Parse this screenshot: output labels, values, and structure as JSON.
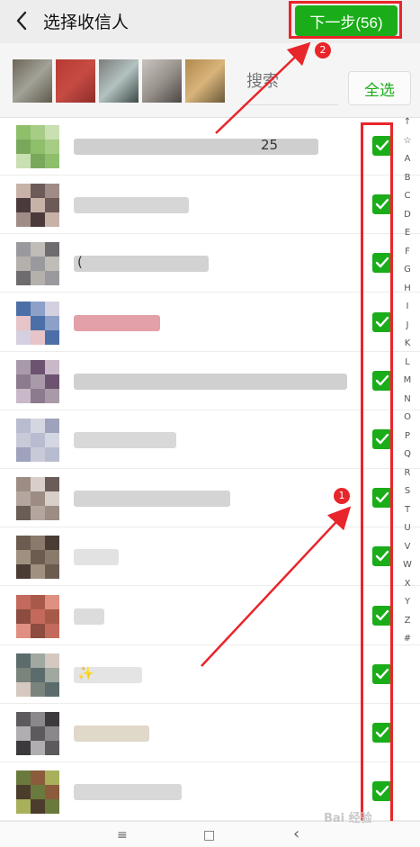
{
  "header": {
    "title": "选择收信人",
    "next_label": "下一步(56)"
  },
  "search": {
    "placeholder": "搜索"
  },
  "select_all_label": "全选",
  "annotations": {
    "one": "1",
    "two": "2"
  },
  "alphabet": [
    "↑",
    "☆",
    "A",
    "B",
    "C",
    "D",
    "E",
    "F",
    "G",
    "H",
    "I",
    "J",
    "K",
    "L",
    "M",
    "N",
    "O",
    "P",
    "Q",
    "R",
    "S",
    "T",
    "U",
    "V",
    "W",
    "X",
    "Y",
    "Z",
    "#"
  ],
  "navbar": {
    "menu_icon": "≡",
    "home_icon": "□",
    "back_icon": "‹"
  },
  "watermark": "Bai 经验",
  "colors": {
    "accent": "#1aad19",
    "annotation": "#e8252a",
    "header_bg": "#ededed"
  },
  "contacts": [
    {
      "visible_text": "25",
      "checked": true
    },
    {
      "visible_text": "",
      "checked": true
    },
    {
      "visible_text": "(",
      "checked": true
    },
    {
      "visible_text": "",
      "checked": true
    },
    {
      "visible_text": "",
      "checked": true
    },
    {
      "visible_text": "",
      "checked": true
    },
    {
      "visible_text": "",
      "checked": true
    },
    {
      "visible_text": "",
      "checked": true
    },
    {
      "visible_text": "",
      "checked": true
    },
    {
      "visible_text": "✨",
      "checked": true
    },
    {
      "visible_text": "",
      "checked": true
    },
    {
      "visible_text": "",
      "checked": true
    }
  ]
}
